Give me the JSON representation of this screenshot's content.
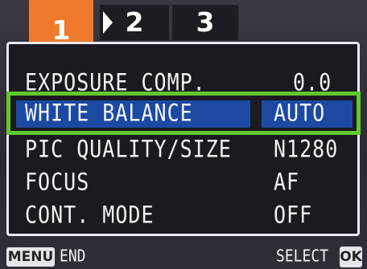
{
  "tabs": [
    {
      "label": "1",
      "active": true
    },
    {
      "label": "2",
      "active": false
    },
    {
      "label": "3",
      "active": false
    }
  ],
  "menu": {
    "selected_index": 1,
    "items": [
      {
        "label": "EXPOSURE COMP.",
        "value": "0.0"
      },
      {
        "label": "WHITE BALANCE",
        "value": "AUTO"
      },
      {
        "label": "PIC QUALITY/SIZE",
        "value": "N1280"
      },
      {
        "label": "FOCUS",
        "value": "AF"
      },
      {
        "label": "CONT. MODE",
        "value": "OFF"
      }
    ]
  },
  "footer": {
    "menu_button": "MENU",
    "menu_action": "END",
    "ok_action": "SELECT",
    "ok_button": "OK"
  },
  "colors": {
    "active_tab": "#f07a2c",
    "highlight_bar": "#1c4aa2",
    "selection_frame": "#60c82c",
    "panel_border": "#e8e8f0"
  }
}
